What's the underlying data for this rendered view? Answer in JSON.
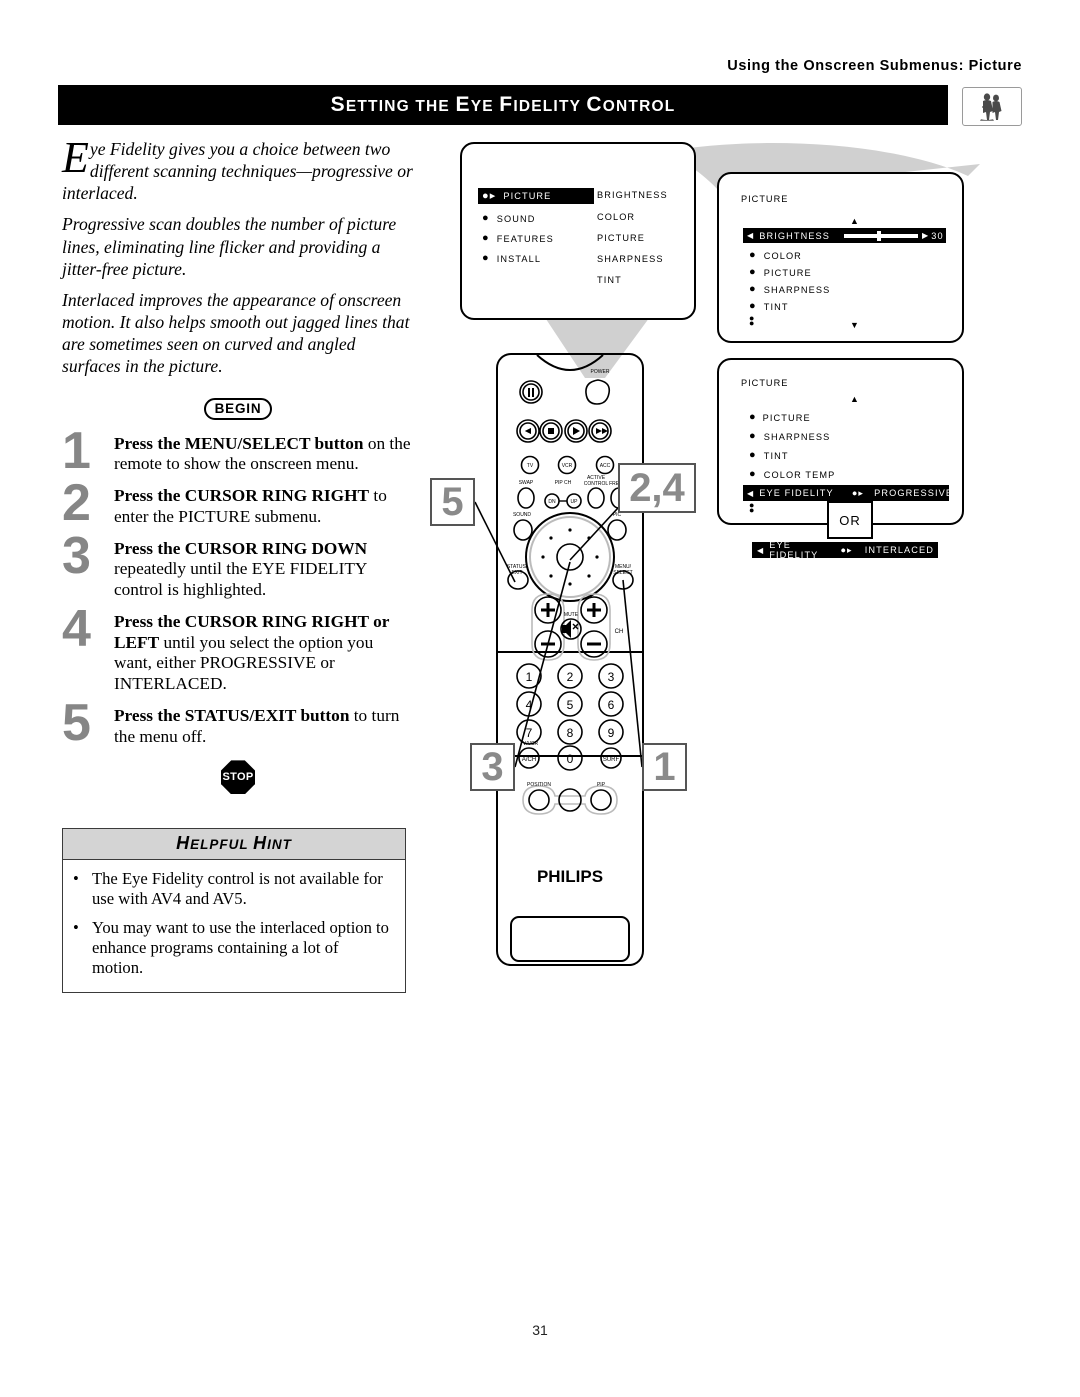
{
  "running_head": "Using the Onscreen Submenus: Picture",
  "title": {
    "text": "Setting the Eye Fidelity Control",
    "parts": [
      "S",
      "ETTING THE ",
      "E",
      "YE ",
      "F",
      "IDELITY ",
      "C",
      "ONTROL"
    ]
  },
  "header_icon": "people-watching-tv-icon",
  "intro": [
    "ye Fidelity gives you a choice between two different scanning techniques—progressive or interlaced.",
    "Progressive scan doubles the number of picture lines, eliminating line flicker and providing a jitter-free picture.",
    "Interlaced improves the appearance of onscreen motion. It also helps smooth out jagged lines that are sometimes seen on curved and angled surfaces in the picture."
  ],
  "dropcap": "E",
  "begin_label": "BEGIN",
  "stop_label": "STOP",
  "steps": [
    {
      "num": "1",
      "bold": "Press the MENU/SELECT button",
      "rest": " on the remote to show the onscreen menu."
    },
    {
      "num": "2",
      "bold": "Press the CURSOR RING RIGHT",
      "rest": " to enter the PICTURE submenu."
    },
    {
      "num": "3",
      "bold": "Press the CURSOR RING DOWN",
      "rest": " repeatedly until the EYE FIDELITY control is highlighted."
    },
    {
      "num": "4",
      "bold": "Press the CURSOR RING RIGHT or LEFT",
      "rest": " until you select the option you want, either PROGRESSIVE or INTERLACED."
    },
    {
      "num": "5",
      "bold": "Press the STATUS/EXIT button",
      "rest": " to turn the menu off."
    }
  ],
  "hint": {
    "heading": "Helpful Hint",
    "heading_parts": [
      "H",
      "ELPFUL ",
      "H",
      "INT"
    ],
    "bullet": "•",
    "items": [
      "The Eye Fidelity control is not available for use with AV4 and AV5.",
      "You may want to use the interlaced option to enhance programs containing a lot of motion."
    ]
  },
  "osd": {
    "main_menu": {
      "left_items": [
        "PICTURE",
        "SOUND",
        "FEATURES",
        "INSTALL"
      ],
      "right_items": [
        "BRIGHTNESS",
        "COLOR",
        "PICTURE",
        "SHARPNESS",
        "TINT"
      ],
      "highlighted": "PICTURE"
    },
    "picture_menu": {
      "title": "PICTURE",
      "items": [
        "BRIGHTNESS",
        "COLOR",
        "PICTURE",
        "SHARPNESS",
        "TINT"
      ],
      "highlighted": "BRIGHTNESS",
      "slider_value": "30",
      "up_arrow": "▲",
      "down_arrow": "▼"
    },
    "eye_fidelity_menu": {
      "title": "PICTURE",
      "items": [
        "PICTURE",
        "SHARPNESS",
        "TINT",
        "COLOR TEMP",
        "EYE FIDELITY"
      ],
      "highlighted": "EYE FIDELITY",
      "highlighted_value": "PROGRESSIVE",
      "up_arrow": "▲",
      "down_arrow": "▼"
    },
    "or_label": "OR",
    "alt_bar": {
      "label": "EYE FIDELITY",
      "value": "INTERLACED"
    }
  },
  "remote": {
    "brand": "PHILIPS",
    "labels": {
      "power": "POWER",
      "tv": "TV",
      "vcr": "VCR",
      "acc": "ACC",
      "swap": "SWAP",
      "pipch": "PIP CH",
      "dn": "DN",
      "up": "UP",
      "active_control": "ACTIVE CONTROL",
      "freeze": "FREEZE",
      "sound": "SOUND",
      "pic": "PIC",
      "status_exit": "STATUS/ EXIT",
      "menu_select": "MENU/ SELECT",
      "mute": "MUTE",
      "ch": "CH",
      "tv_vcr": "TV/VCR",
      "a_ch": "A/CH",
      "surf": "SURF",
      "position": "POSITION",
      "pip": "PIP"
    },
    "keypad": [
      "1",
      "2",
      "3",
      "4",
      "5",
      "6",
      "7",
      "8",
      "9",
      "0"
    ]
  },
  "callouts": [
    {
      "id": "callout-2-4",
      "label": "2,4"
    },
    {
      "id": "callout-5",
      "label": "5"
    },
    {
      "id": "callout-3",
      "label": "3"
    },
    {
      "id": "callout-1",
      "label": "1"
    }
  ],
  "page_number": "31",
  "colors": {
    "callout_gray": "#8a8a8a",
    "step_gray": "#868686",
    "hint_header": "#d4d4d4",
    "arrow_gray": "#d0d0d0"
  }
}
